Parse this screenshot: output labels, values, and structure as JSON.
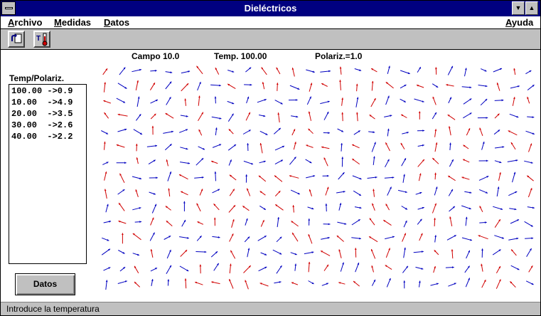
{
  "window": {
    "title": "Dieléctricos"
  },
  "titlebar": {
    "minimize_glyph": "▼",
    "maximize_glyph": "▲"
  },
  "menu": {
    "archivo": "Archivo",
    "medidas": "Medidas",
    "datos": "Datos",
    "ayuda": "Ayuda"
  },
  "toolbar": {
    "temp_icon_letter": "T"
  },
  "status_line": {
    "campo": "Campo 10.0",
    "temp": "Temp. 100.00",
    "polariz": "Polariz.=1.0"
  },
  "list": {
    "title": "Temp/Polariz.",
    "rows": [
      "100.00 ->0.9",
      "10.00  ->4.9",
      "20.00  ->3.5",
      "30.00  ->2.6",
      "40.00  ->2.2"
    ]
  },
  "datos_button": "Datos",
  "status_bar": "Introduce la temperatura",
  "colors": {
    "blue_dipole": "#0000c0",
    "red_dipole": "#d00000",
    "title_bg": "#000080"
  },
  "dipole_field": {
    "cols": 28,
    "rows": 15,
    "net_direction_degrees": 30,
    "colors": [
      "blue",
      "red"
    ]
  }
}
